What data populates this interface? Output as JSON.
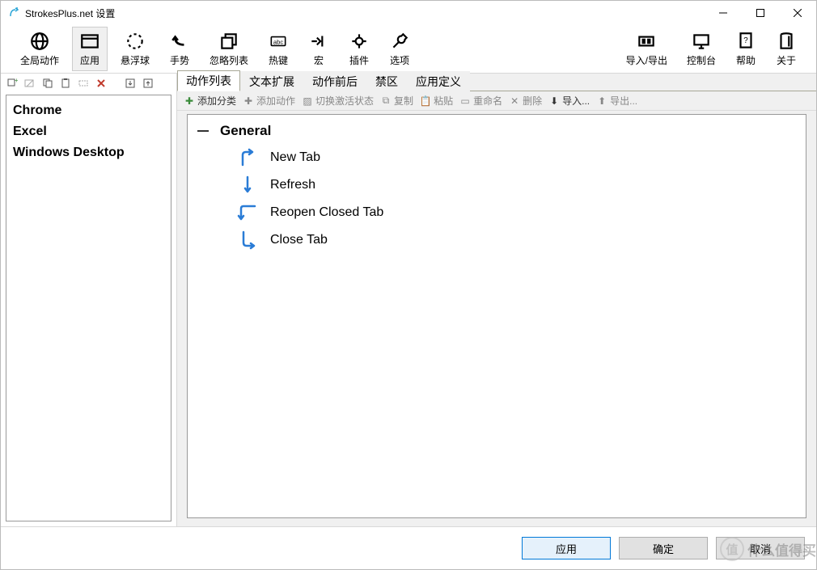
{
  "window": {
    "title": "StrokesPlus.net 设置"
  },
  "main_toolbar": {
    "global": "全局动作",
    "apps": "应用",
    "floater": "悬浮球",
    "gestures": "手势",
    "ignore": "忽略列表",
    "hotkeys": "热键",
    "macro": "宏",
    "plugins": "插件",
    "options": "选项",
    "import_export": "导入/导出",
    "console": "控制台",
    "help": "帮助",
    "about": "关于"
  },
  "sidebar": {
    "items": [
      {
        "label": "Chrome"
      },
      {
        "label": "Excel"
      },
      {
        "label": "Windows Desktop"
      }
    ]
  },
  "tabs": {
    "action_list": "动作列表",
    "text_expand": "文本扩展",
    "before_after": "动作前后",
    "forbidden": "禁区",
    "app_def": "应用定义"
  },
  "sub_toolbar": {
    "add_category": "添加分类",
    "add_action": "添加动作",
    "toggle_active": "切换激活状态",
    "copy": "复制",
    "paste": "粘贴",
    "rename": "重命名",
    "delete": "删除",
    "import": "导入...",
    "export": "导出..."
  },
  "tree": {
    "group": "General",
    "actions": [
      {
        "label": "New Tab"
      },
      {
        "label": "Refresh"
      },
      {
        "label": "Reopen Closed Tab"
      },
      {
        "label": "Close Tab"
      }
    ]
  },
  "footer": {
    "apply": "应用",
    "ok": "确定",
    "cancel": "取消"
  },
  "watermark": "什么值得买"
}
